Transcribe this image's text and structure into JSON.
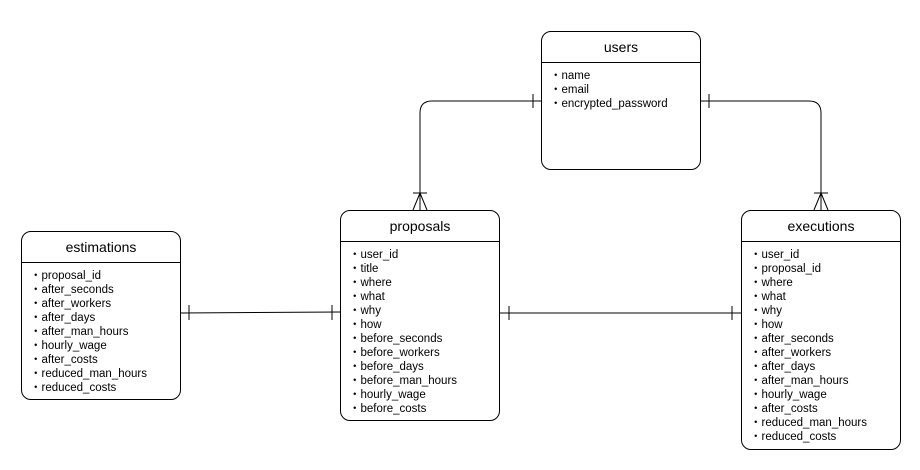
{
  "entities": {
    "users": {
      "title": "users",
      "fields": [
        "name",
        "email",
        "encrypted_password"
      ]
    },
    "proposals": {
      "title": "proposals",
      "fields": [
        "user_id",
        "title",
        "where",
        "what",
        "why",
        "how",
        "before_seconds",
        "before_workers",
        "before_days",
        "before_man_hours",
        "hourly_wage",
        "before_costs"
      ]
    },
    "estimations": {
      "title": "estimations",
      "fields": [
        "proposal_id",
        "after_seconds",
        "after_workers",
        "after_days",
        "after_man_hours",
        "hourly_wage",
        "after_costs",
        "reduced_man_hours",
        "reduced_costs"
      ]
    },
    "executions": {
      "title": "executions",
      "fields": [
        "user_id",
        "proposal_id",
        "where",
        "what",
        "why",
        "how",
        "after_seconds",
        "after_workers",
        "after_days",
        "after_man_hours",
        "hourly_wage",
        "after_costs",
        "reduced_man_hours",
        "reduced_costs"
      ]
    }
  },
  "relationships": [
    {
      "from": "users",
      "from_cardinality": "one",
      "to": "proposals",
      "to_cardinality": "one-or-many"
    },
    {
      "from": "users",
      "from_cardinality": "one",
      "to": "executions",
      "to_cardinality": "one-or-many"
    },
    {
      "from": "estimations",
      "from_cardinality": "one",
      "to": "proposals",
      "to_cardinality": "one"
    },
    {
      "from": "proposals",
      "from_cardinality": "one",
      "to": "executions",
      "to_cardinality": "one"
    }
  ]
}
